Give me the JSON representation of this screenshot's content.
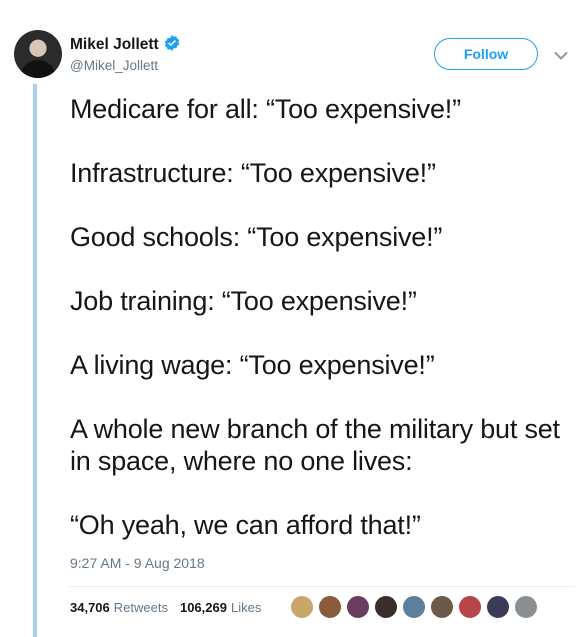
{
  "author": {
    "name": "Mikel Jollett",
    "handle": "@Mikel_Jollett",
    "verified": true
  },
  "follow_label": "Follow",
  "tweet": {
    "lines": [
      "Medicare for all: “Too expensive!”",
      "Infrastructure: “Too expensive!”",
      "Good schools: “Too expensive!”",
      "Job training: “Too expensive!”",
      "A living wage: “Too expensive!”",
      "A whole new branch of the military but set in space, where no one lives:",
      "“Oh yeah, we can afford that!”"
    ],
    "timestamp": "9:27 AM - 9 Aug 2018"
  },
  "stats": {
    "retweets_count": "34,706",
    "retweets_label": "Retweets",
    "likes_count": "106,269",
    "likes_label": "Likes"
  },
  "colors": {
    "accent": "#1da1f2",
    "thread_line": "#a7d2e6",
    "secondary_text": "#657786"
  },
  "liker_avatar_colors": [
    "#c9a76a",
    "#8a5a3c",
    "#6b3d5e",
    "#3a2f2a",
    "#5d7f9a",
    "#6c5a48",
    "#b7464a",
    "#3c3c5a",
    "#8a8f94"
  ]
}
